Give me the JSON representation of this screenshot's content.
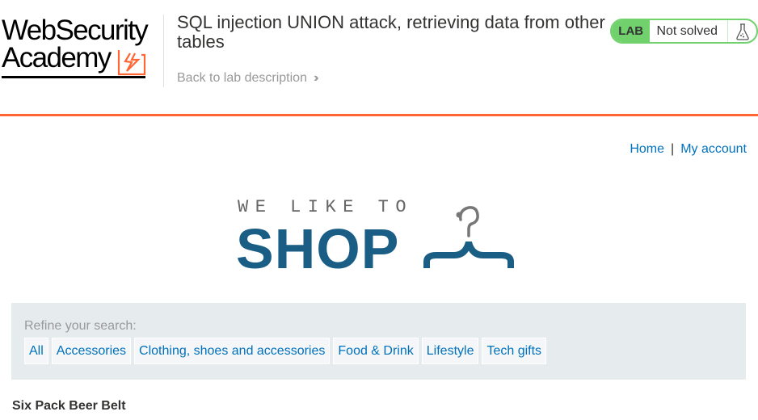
{
  "header": {
    "logo": {
      "line1": "WebSecurity",
      "line2": "Academy"
    },
    "lab_title": "SQL injection UNION attack, retrieving data from other tables",
    "back_link": "Back to lab description",
    "lab_status": {
      "badge": "LAB",
      "state": "Not solved",
      "icon": "flask-icon"
    }
  },
  "nav": {
    "home": "Home",
    "separator": "|",
    "my_account": "My account"
  },
  "shop_logo": {
    "tagline": "WE LIKE TO",
    "word": "SHOP",
    "icon": "hanger-icon"
  },
  "filter": {
    "label": "Refine your search:",
    "categories": [
      "All",
      "Accessories",
      "Clothing, shoes and accessories",
      "Food & Drink",
      "Lifestyle",
      "Tech gifts"
    ]
  },
  "product": {
    "name": "Six Pack Beer Belt"
  },
  "colors": {
    "accent_orange": "#ff6633",
    "link_blue": "#0071bc",
    "lab_green": "#70d16d",
    "shop_blue": "#1b5e85"
  }
}
